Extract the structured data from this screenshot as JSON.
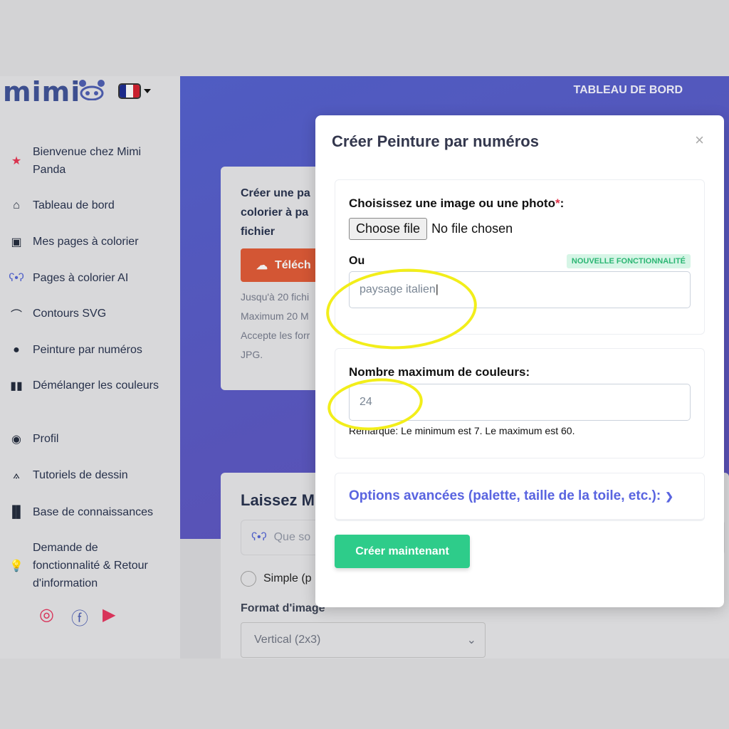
{
  "brand": {
    "logo_text": "mimi",
    "language": "FR"
  },
  "sidebar": {
    "items": [
      {
        "label": "Bienvenue chez Mimi Panda",
        "icon": "star-icon"
      },
      {
        "label": "Tableau de bord",
        "icon": "home-icon"
      },
      {
        "label": "Mes pages à colorier",
        "icon": "image-icon"
      },
      {
        "label": "Pages à colorier AI",
        "icon": "panda-icon"
      },
      {
        "label": "Contours SVG",
        "icon": "bezier-icon"
      },
      {
        "label": "Peinture par numéros",
        "icon": "palette-icon"
      },
      {
        "label": "Démélanger les couleurs",
        "icon": "swatch-icon"
      },
      {
        "label": "Profil",
        "icon": "user-icon"
      },
      {
        "label": "Tutoriels de dessin",
        "icon": "compass-icon"
      },
      {
        "label": "Base de connaissances",
        "icon": "books-icon"
      },
      {
        "label": "Demande de fonctionnalité & Retour d'information",
        "icon": "lightbulb-icon"
      }
    ],
    "social": [
      "instagram-icon",
      "facebook-icon",
      "youtube-icon"
    ]
  },
  "header": {
    "nav": "TABLEAU DE BORD"
  },
  "background": {
    "card1_title": "Créer une pa colorier à pa fichier",
    "upload_label": "Téléch",
    "notes": [
      "Jusqu'à 20 fichi",
      "Maximum 20 M",
      "Accepte les forr",
      "JPG."
    ],
    "card2_title": "Laissez M",
    "prompt_placeholder": "Que so",
    "radio_label": "Simple (p",
    "format_label": "Format d'image",
    "format_value": "Vertical (2x3)"
  },
  "modal": {
    "title": "Créer Peinture par numéros",
    "close": "×",
    "image_label": "Choisissez une image ou une photo",
    "required": "*",
    "choose_file": "Choose file",
    "no_file": "No file chosen",
    "or": "Ou",
    "badge": "NOUVELLE FONCTIONNALITÉ",
    "prompt_value": "paysage italien",
    "colors_label": "Nombre maximum de couleurs:",
    "colors_value": "24",
    "colors_note": "Remarque: Le minimum est 7. Le maximum est 60.",
    "advanced": "Options avancées (palette, taille de la toile, etc.):",
    "create": "Créer maintenant"
  },
  "colors": {
    "accent": "#5964e0",
    "success": "#2ecc8a",
    "highlight": "#f2ee1a",
    "upload": "#d35634"
  }
}
